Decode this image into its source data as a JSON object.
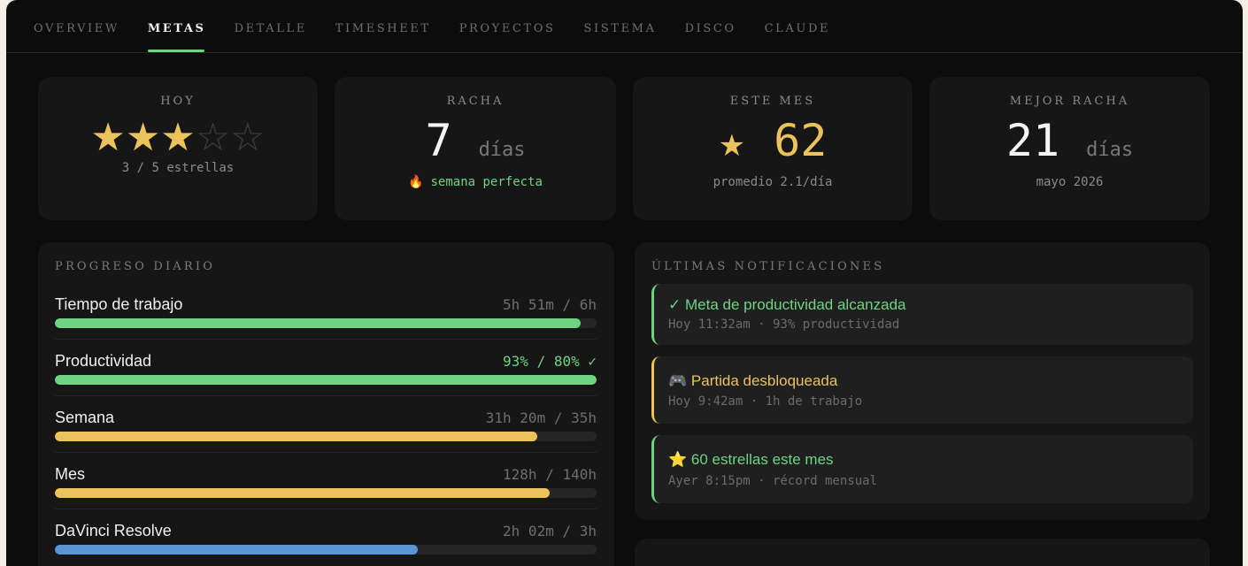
{
  "tabs": [
    "OVERVIEW",
    "METAS",
    "DETALLE",
    "TIMESHEET",
    "PROYECTOS",
    "SISTEMA",
    "DISCO",
    "CLAUDE"
  ],
  "active_tab": "METAS",
  "stats": {
    "hoy": {
      "label": "HOY",
      "stars_filled": 3,
      "stars_total": 5,
      "sub": "3 / 5 estrellas"
    },
    "racha": {
      "label": "RACHA",
      "value": "7",
      "unit": "días",
      "sub": "semana perfecta",
      "icon": "fire-icon"
    },
    "mes": {
      "label": "ESTE MES",
      "value": "62",
      "sub": "promedio 2.1/día",
      "icon": "star-icon"
    },
    "mejor": {
      "label": "MEJOR RACHA",
      "value": "21",
      "unit": "días",
      "sub": "mayo 2026"
    }
  },
  "progress": {
    "title": "PROGRESO DIARIO",
    "items": [
      {
        "name": "Tiempo de trabajo",
        "value": "5h 51m / 6h",
        "fraction": 0.97,
        "color": "#6fd481",
        "ok": false
      },
      {
        "name": "Productividad",
        "value": "93% / 80% ✓",
        "fraction": 1.0,
        "color": "#6fd481",
        "ok": true
      },
      {
        "name": "Semana",
        "value": "31h 20m / 35h",
        "fraction": 0.89,
        "color": "#ecc35a",
        "ok": false
      },
      {
        "name": "Mes",
        "value": "128h / 140h",
        "fraction": 0.914,
        "color": "#ecc35a",
        "ok": false
      },
      {
        "name": "DaVinci Resolve",
        "value": "2h 02m / 3h",
        "fraction": 0.67,
        "color": "#5b95d6",
        "ok": false
      }
    ]
  },
  "notifications": {
    "title": "ÚLTIMAS NOTIFICACIONES",
    "items": [
      {
        "icon": "check-icon",
        "glyph": "✓",
        "title": "Meta de productividad alcanzada",
        "sub": "Hoy 11:32am · 93% productividad",
        "color": "#6fd481"
      },
      {
        "icon": "gamepad-icon",
        "glyph": "🎮",
        "title": "Partida desbloqueada",
        "sub": "Hoy 9:42am · 1h de trabajo",
        "color": "#ecc35a"
      },
      {
        "icon": "star-icon",
        "glyph": "⭐",
        "title": "60 estrellas este mes",
        "sub": "Ayer 8:15pm · récord mensual",
        "color": "#6fd481"
      }
    ]
  }
}
